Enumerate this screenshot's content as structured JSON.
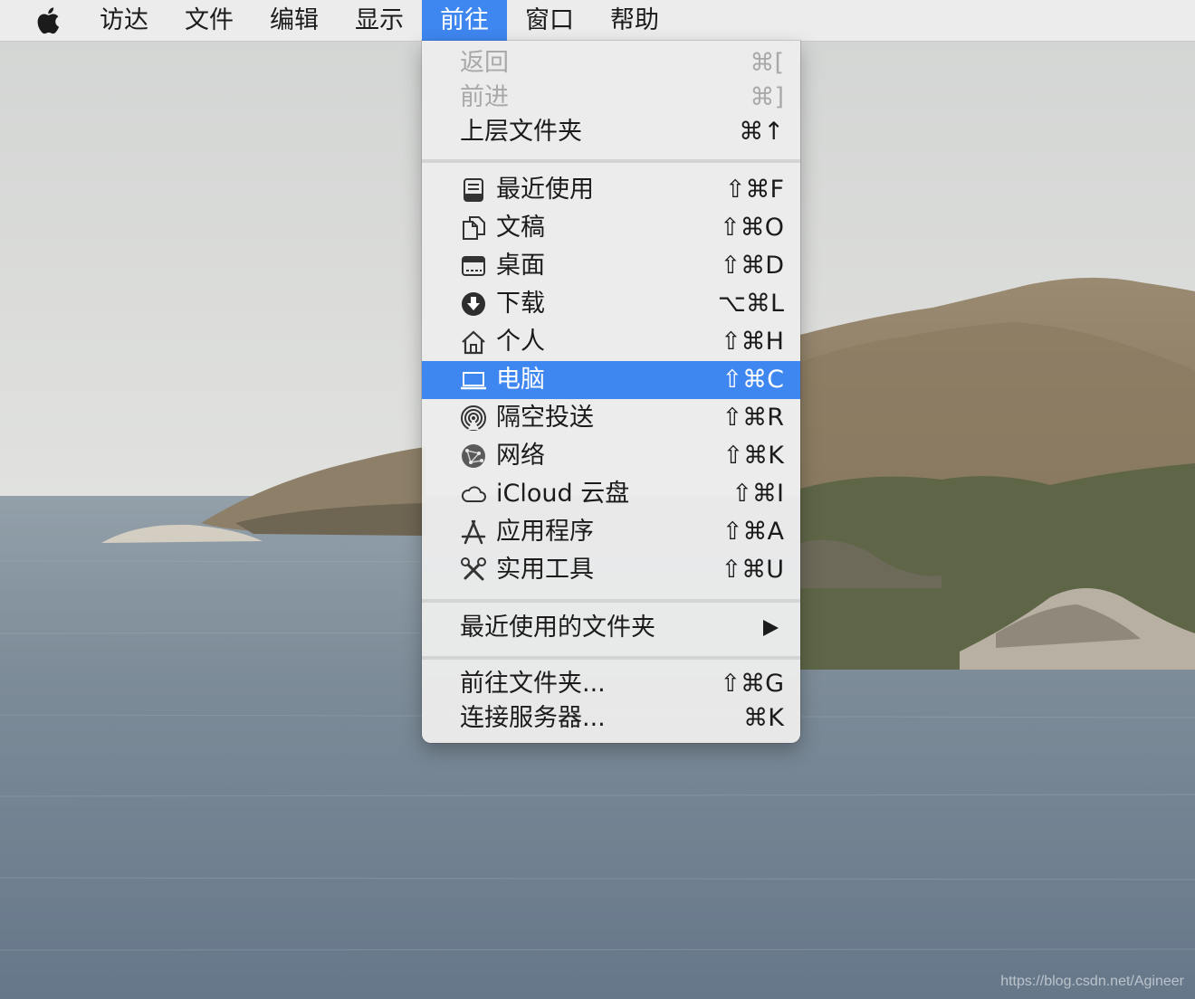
{
  "menubar": {
    "items": [
      {
        "label": "访达"
      },
      {
        "label": "文件"
      },
      {
        "label": "编辑"
      },
      {
        "label": "显示"
      },
      {
        "label": "前往",
        "active": true
      },
      {
        "label": "窗口"
      },
      {
        "label": "帮助"
      }
    ]
  },
  "go_menu": {
    "nav": [
      {
        "label": "返回",
        "shortcut": "⌘[",
        "enabled": false
      },
      {
        "label": "前进",
        "shortcut": "⌘]",
        "enabled": false
      },
      {
        "label": "上层文件夹",
        "shortcut": "⌘↑",
        "enabled": true
      }
    ],
    "places": [
      {
        "label": "最近使用",
        "shortcut": "⇧⌘F",
        "icon": "recents-icon"
      },
      {
        "label": "文稿",
        "shortcut": "⇧⌘O",
        "icon": "documents-icon"
      },
      {
        "label": "桌面",
        "shortcut": "⇧⌘D",
        "icon": "desktop-icon"
      },
      {
        "label": "下载",
        "shortcut": "⌥⌘L",
        "icon": "downloads-icon"
      },
      {
        "label": "个人",
        "shortcut": "⇧⌘H",
        "icon": "home-icon"
      },
      {
        "label": "电脑",
        "shortcut": "⇧⌘C",
        "icon": "computer-icon",
        "highlighted": true
      },
      {
        "label": "隔空投送",
        "shortcut": "⇧⌘R",
        "icon": "airdrop-icon"
      },
      {
        "label": "网络",
        "shortcut": "⇧⌘K",
        "icon": "network-icon"
      },
      {
        "label": "iCloud 云盘",
        "shortcut": "⇧⌘I",
        "icon": "icloud-icon"
      },
      {
        "label": "应用程序",
        "shortcut": "⇧⌘A",
        "icon": "applications-icon"
      },
      {
        "label": "实用工具",
        "shortcut": "⇧⌘U",
        "icon": "utilities-icon"
      }
    ],
    "recent_folders": {
      "label": "最近使用的文件夹",
      "icon": "submenu-arrow-icon"
    },
    "actions": [
      {
        "label": "前往文件夹...",
        "shortcut": "⇧⌘G"
      },
      {
        "label": "连接服务器...",
        "shortcut": "⌘K"
      }
    ]
  },
  "colors": {
    "highlight": "#3e86f0",
    "menu_bg": "#ececec",
    "disabled_text": "#a9a9a9"
  },
  "watermark": "https://blog.csdn.net/Agineer"
}
